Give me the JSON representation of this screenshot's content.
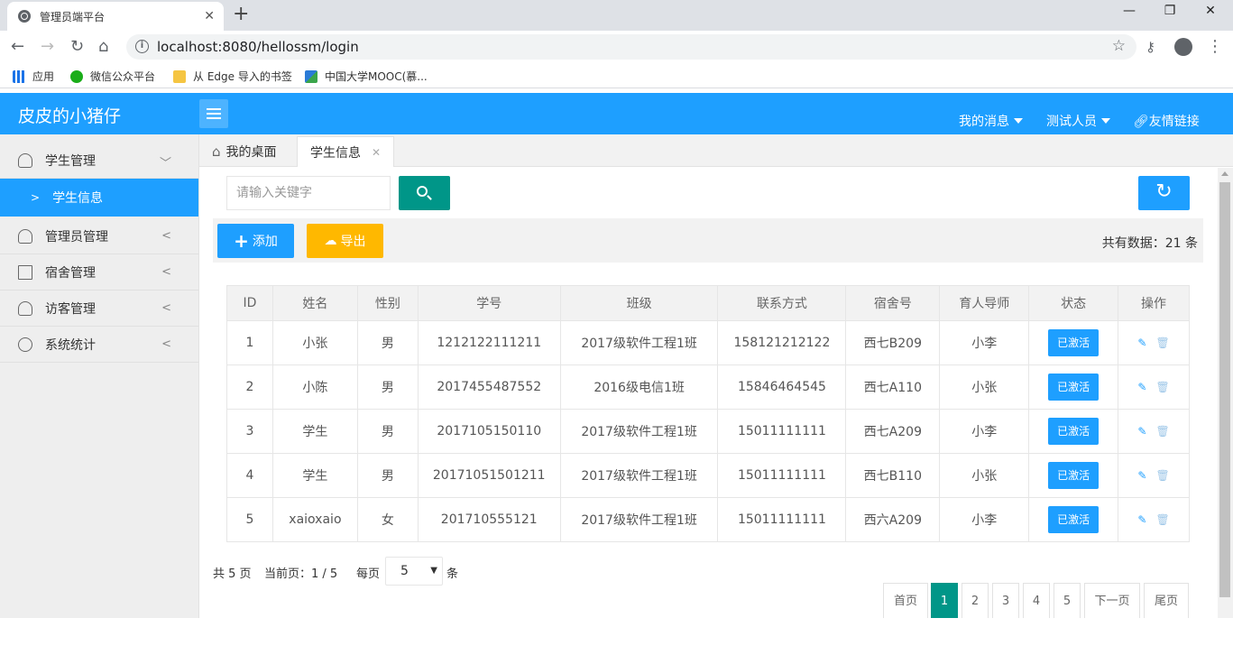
{
  "browser": {
    "tab_title": "管理员端平台",
    "new_tab": "+",
    "url": "localhost:8080/hellossm/login",
    "bookmarks": [
      "应用",
      "微信公众平台",
      "从 Edge 导入的书签",
      "中国大学MOOC(慕..."
    ]
  },
  "app": {
    "logo": "皮皮的小猪仔",
    "nav": [
      "我的消息",
      "测试人员",
      "友情链接"
    ]
  },
  "sidebar": {
    "items": [
      {
        "label": "学生管理",
        "icon": "user-icon"
      },
      {
        "label": "学生信息",
        "icon": "chevron-right-icon"
      },
      {
        "label": "管理员管理",
        "icon": "admin-icon"
      },
      {
        "label": "宿舍管理",
        "icon": "grid-icon"
      },
      {
        "label": "访客管理",
        "icon": "visitor-icon"
      },
      {
        "label": "系统统计",
        "icon": "chart-icon"
      }
    ]
  },
  "tabs": {
    "home": "我的桌面",
    "current": "学生信息"
  },
  "search": {
    "placeholder": "请输入关键字"
  },
  "actions": {
    "add": "添加",
    "export": "导出",
    "total": "共有数据：21 条"
  },
  "table": {
    "headers": [
      "ID",
      "姓名",
      "性别",
      "学号",
      "班级",
      "联系方式",
      "宿舍号",
      "育人导师",
      "状态",
      "操作"
    ],
    "rows": [
      [
        "1",
        "小张",
        "男",
        "1212122111211",
        "2017级软件工程1班",
        "158121212122",
        "西七B209",
        "小李",
        "已激活"
      ],
      [
        "2",
        "小陈",
        "男",
        "2017455487552",
        "2016级电信1班",
        "15846464545",
        "西七A110",
        "小张",
        "已激活"
      ],
      [
        "3",
        "学生",
        "男",
        "2017105150110",
        "2017级软件工程1班",
        "15011111111",
        "西七A209",
        "小李",
        "已激活"
      ],
      [
        "4",
        "学生",
        "男",
        "20171051501211",
        "2017级软件工程1班",
        "15011111111",
        "西七B110",
        "小张",
        "已激活"
      ],
      [
        "5",
        "xaioxaio",
        "女",
        "201710555121",
        "2017级软件工程1班",
        "15011111111",
        "西六A209",
        "小李",
        "已激活"
      ]
    ]
  },
  "pagination": {
    "total_pages": "共 5 页",
    "current": "当前页：1 / 5",
    "per_page_label": "每页",
    "per_page_value": "5",
    "unit": "条",
    "buttons": [
      "首页",
      "1",
      "2",
      "3",
      "4",
      "5",
      "下一页",
      "尾页"
    ]
  },
  "colors": {
    "primary": "#1e9fff",
    "teal": "#009688",
    "orange": "#ffb800"
  }
}
